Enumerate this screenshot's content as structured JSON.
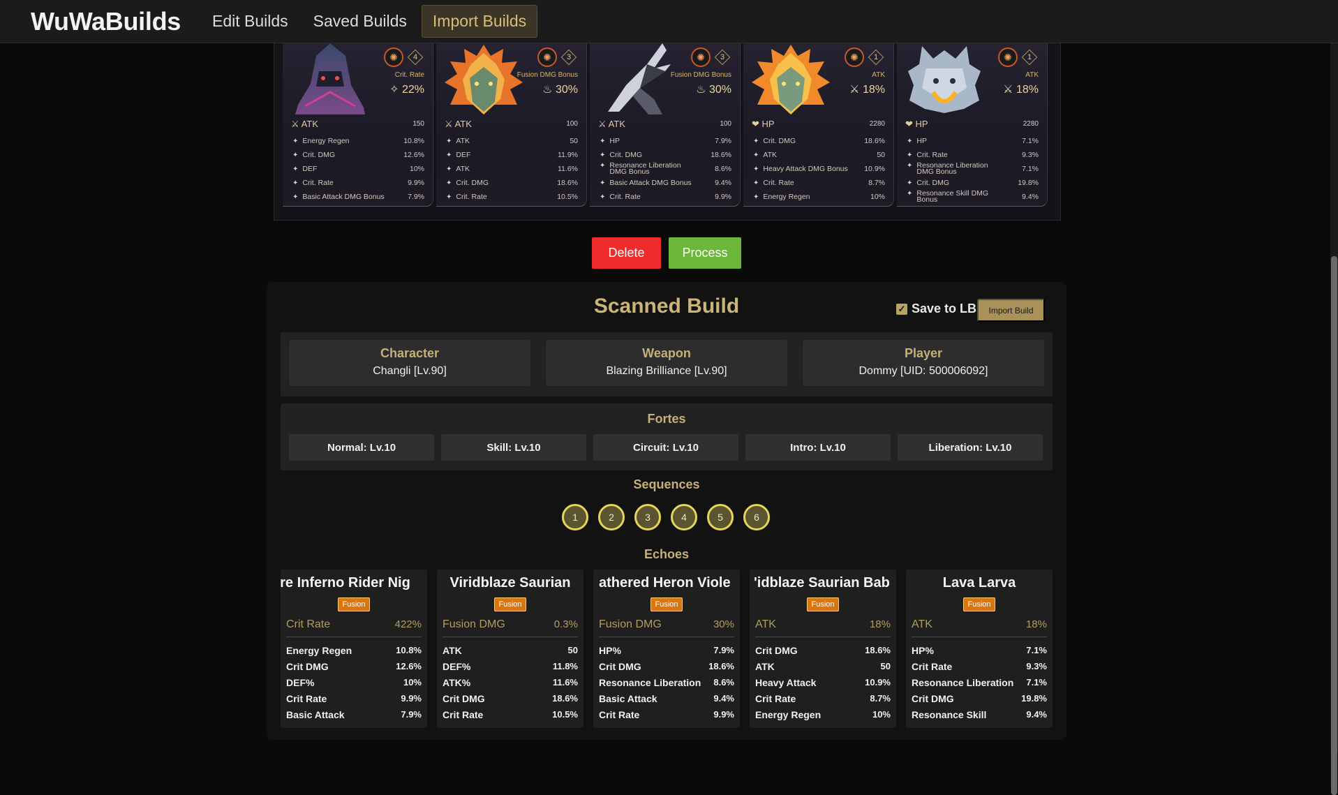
{
  "nav": {
    "brand": "WuWaBuilds",
    "links": [
      "Edit Builds",
      "Saved Builds",
      "Import Builds"
    ]
  },
  "game_echoes": [
    {
      "cost": "4",
      "main_label": "Crit. Rate",
      "main_value": "22%",
      "main_stat": "ATK",
      "main_stat_value": "150",
      "subs": [
        [
          "Energy Regen",
          "10.8%"
        ],
        [
          "Crit. DMG",
          "12.6%"
        ],
        [
          "DEF",
          "10%"
        ],
        [
          "Crit. Rate",
          "9.9%"
        ],
        [
          "Basic Attack DMG Bonus",
          "7.9%"
        ]
      ]
    },
    {
      "cost": "3",
      "main_label": "Fusion DMG Bonus",
      "main_value": "30%",
      "main_stat": "ATK",
      "main_stat_value": "100",
      "subs": [
        [
          "ATK",
          "50"
        ],
        [
          "DEF",
          "11.9%"
        ],
        [
          "ATK",
          "11.6%"
        ],
        [
          "Crit. DMG",
          "18.6%"
        ],
        [
          "Crit. Rate",
          "10.5%"
        ]
      ]
    },
    {
      "cost": "3",
      "main_label": "Fusion DMG Bonus",
      "main_value": "30%",
      "main_stat": "ATK",
      "main_stat_value": "100",
      "subs": [
        [
          "HP",
          "7.9%"
        ],
        [
          "Crit. DMG",
          "18.6%"
        ],
        [
          "Resonance Liberation DMG Bonus",
          "8.6%"
        ],
        [
          "Basic Attack DMG Bonus",
          "9.4%"
        ],
        [
          "Crit. Rate",
          "9.9%"
        ]
      ]
    },
    {
      "cost": "1",
      "main_label": "ATK",
      "main_value": "18%",
      "main_stat": "HP",
      "main_stat_value": "2280",
      "subs": [
        [
          "Crit. DMG",
          "18.6%"
        ],
        [
          "ATK",
          "50"
        ],
        [
          "Heavy Attack DMG Bonus",
          "10.9%"
        ],
        [
          "Crit. Rate",
          "8.7%"
        ],
        [
          "Energy Regen",
          "10%"
        ]
      ]
    },
    {
      "cost": "1",
      "main_label": "ATK",
      "main_value": "18%",
      "main_stat": "HP",
      "main_stat_value": "2280",
      "subs": [
        [
          "HP",
          "7.1%"
        ],
        [
          "Crit. Rate",
          "9.3%"
        ],
        [
          "Resonance Liberation DMG Bonus",
          "7.1%"
        ],
        [
          "Crit. DMG",
          "19.8%"
        ],
        [
          "Resonance Skill DMG Bonus",
          "9.4%"
        ]
      ]
    }
  ],
  "actions": {
    "delete": "Delete",
    "process": "Process"
  },
  "scanned": {
    "title": "Scanned Build",
    "save_lb": "Save to LB",
    "save_lb_checked": true,
    "import_button": "Import Build",
    "character_label": "Character",
    "character_value": "Changli [Lv.90]",
    "weapon_label": "Weapon",
    "weapon_value": "Blazing Brilliance [Lv.90]",
    "player_label": "Player",
    "player_value": "Dommy [UID: 500006092]",
    "fortes_title": "Fortes",
    "fortes": [
      "Normal: Lv.10",
      "Skill: Lv.10",
      "Circuit: Lv.10",
      "Intro: Lv.10",
      "Liberation: Lv.10"
    ],
    "sequences_title": "Sequences",
    "sequences": [
      "1",
      "2",
      "3",
      "4",
      "5",
      "6"
    ],
    "echoes_title": "Echoes",
    "echoes": [
      {
        "name": "are Inferno Rider   Nig",
        "type": "Fusion",
        "main": "Crit Rate",
        "main_value": "422%",
        "subs": [
          [
            "Energy Regen",
            "10.8%"
          ],
          [
            "Crit DMG",
            "12.6%"
          ],
          [
            "DEF%",
            "10%"
          ],
          [
            "Crit Rate",
            "9.9%"
          ],
          [
            "Basic Attack",
            "7.9%"
          ]
        ]
      },
      {
        "name": "Viridblaze Saurian",
        "type": "Fusion",
        "main": "Fusion DMG",
        "main_value": "0.3%",
        "subs": [
          [
            "ATK",
            "50"
          ],
          [
            "DEF%",
            "11.8%"
          ],
          [
            "ATK%",
            "11.6%"
          ],
          [
            "Crit DMG",
            "18.6%"
          ],
          [
            "Crit Rate",
            "10.5%"
          ]
        ]
      },
      {
        "name": "athered Heron   Viole",
        "type": "Fusion",
        "main": "Fusion DMG",
        "main_value": "30%",
        "subs": [
          [
            "HP%",
            "7.9%"
          ],
          [
            "Crit DMG",
            "18.6%"
          ],
          [
            "Resonance Liberation",
            "8.6%"
          ],
          [
            "Basic Attack",
            "9.4%"
          ],
          [
            "Crit Rate",
            "9.9%"
          ]
        ]
      },
      {
        "name": "'idblaze Saurian   Bab",
        "type": "Fusion",
        "main": "ATK",
        "main_value": "18%",
        "subs": [
          [
            "Crit DMG",
            "18.6%"
          ],
          [
            "ATK",
            "50"
          ],
          [
            "Heavy Attack",
            "10.9%"
          ],
          [
            "Crit Rate",
            "8.7%"
          ],
          [
            "Energy Regen",
            "10%"
          ]
        ]
      },
      {
        "name": "Lava Larva",
        "type": "Fusion",
        "main": "ATK",
        "main_value": "18%",
        "subs": [
          [
            "HP%",
            "7.1%"
          ],
          [
            "Crit Rate",
            "9.3%"
          ],
          [
            "Resonance Liberation",
            "7.1%"
          ],
          [
            "Crit DMG",
            "19.8%"
          ],
          [
            "Resonance Skill",
            "9.4%"
          ]
        ]
      }
    ]
  },
  "colors": {
    "accent_gold": "#c6b07a",
    "delete_red": "#ef2b2b",
    "process_green": "#6bb73a",
    "fusion_orange": "#d9760f",
    "sequence_ring": "#e6d55a"
  },
  "icons": [
    "sonata-icon",
    "cost-icon",
    "atk-icon",
    "hp-icon",
    "substat-star-icon",
    "checkbox-icon"
  ]
}
